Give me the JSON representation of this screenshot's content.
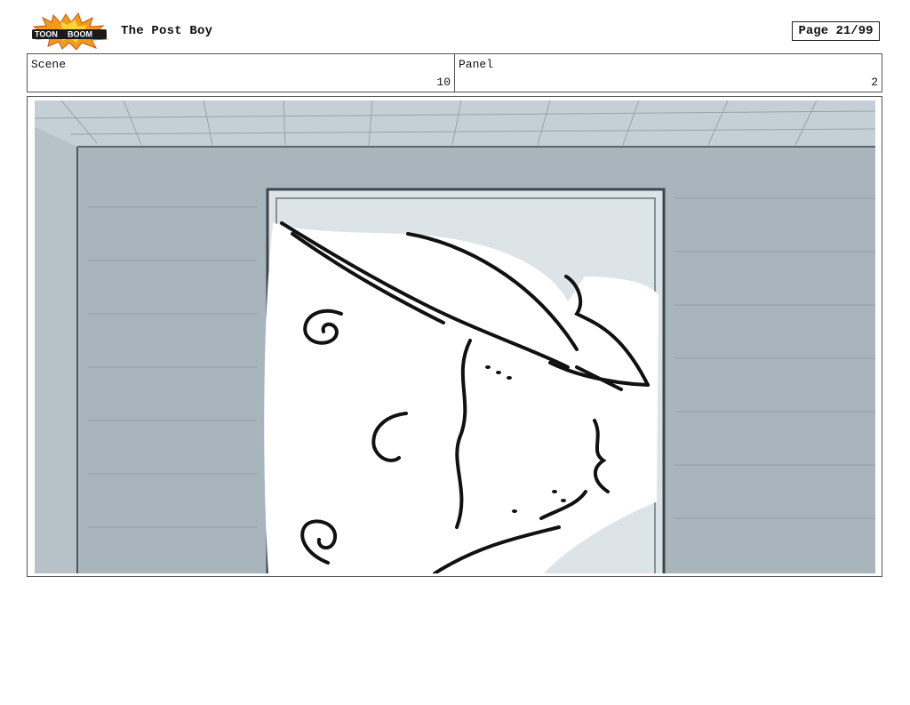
{
  "header": {
    "logo_text_left": "TOON",
    "logo_text_right": "BOOM",
    "title": "The Post Boy",
    "page": "Page 21/99"
  },
  "info": {
    "scene_label": "Scene",
    "scene_value": "10",
    "panel_label": "Panel",
    "panel_value": "2"
  },
  "panel": {
    "colors": {
      "wall": "#a9b5bd",
      "wall_shadow": "#98a5ae",
      "ceiling": "#c5d0d6",
      "doorway": "#dde4e7",
      "ink": "#111111",
      "figure": "#ffffff"
    }
  }
}
